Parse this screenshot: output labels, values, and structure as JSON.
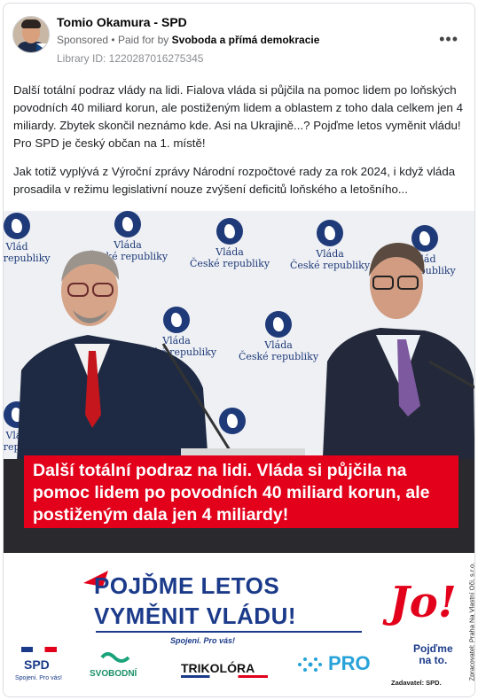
{
  "post": {
    "author": "Tomio Okamura - SPD",
    "sponsored": "Sponsored",
    "paid_for_prefix": "Paid for by",
    "sponsor_name": "Svoboda a přímá demokracie",
    "library_id": "Library ID: 1220287016275345",
    "more": "•••",
    "paragraph_1": "Další totální podraz vlády na lidi. Fialova vláda si půjčila na pomoc lidem po loňských povodních 40 miliard korun, ale postiženým lidem a oblastem z toho dala celkem jen 4 miliardy. Zbytek skončil neznámo kde. Asi na Ukrajině...? Pojďme letos vyměnit vládu! Pro SPD je český občan na 1. místě!",
    "paragraph_2": "Jak totiž vyplývá z Výroční zprávy Národní rozpočtové rady za rok 2024, i když vláda prosadila v režimu legislativní nouze zvýšení deficitů loňského a letošního..."
  },
  "image": {
    "backdrop_label_line1": "Vláda",
    "backdrop_label_line2": "České republiky",
    "backdrop_label_short": "Vlád",
    "backdrop_label_short2": "ské republiky",
    "backdrop_label_short3": "ká republiky",
    "banner_text": "Další totální podraz na lidi. Vláda si půjčila na pomoc lidem po povodních 40 miliard korun, ale postiženým dala jen 4 miliardy!",
    "promo_title_line1": "POJĎME LETOS",
    "promo_title_line2": "VYMĚNIT VLÁDU!",
    "promo_subtitle": "Spojeni. Pro vás!",
    "jo": "Jo!",
    "jo_sub_line1": "Pojďme",
    "jo_sub_line2": "na to.",
    "vertical_text": "Zpracovatel: Praha Na Vlastní Oči, s.r.o.",
    "zadavatel": "Zadavatel: SPD.",
    "parties": [
      "SPD",
      "SVOBODNÍ",
      "TRIKOLÓRA",
      "PRO"
    ],
    "spd_sub": "Spojeni. Pro vás!"
  },
  "colors": {
    "banner_red": "#e2001a",
    "brand_blue": "#1b3b8a"
  }
}
